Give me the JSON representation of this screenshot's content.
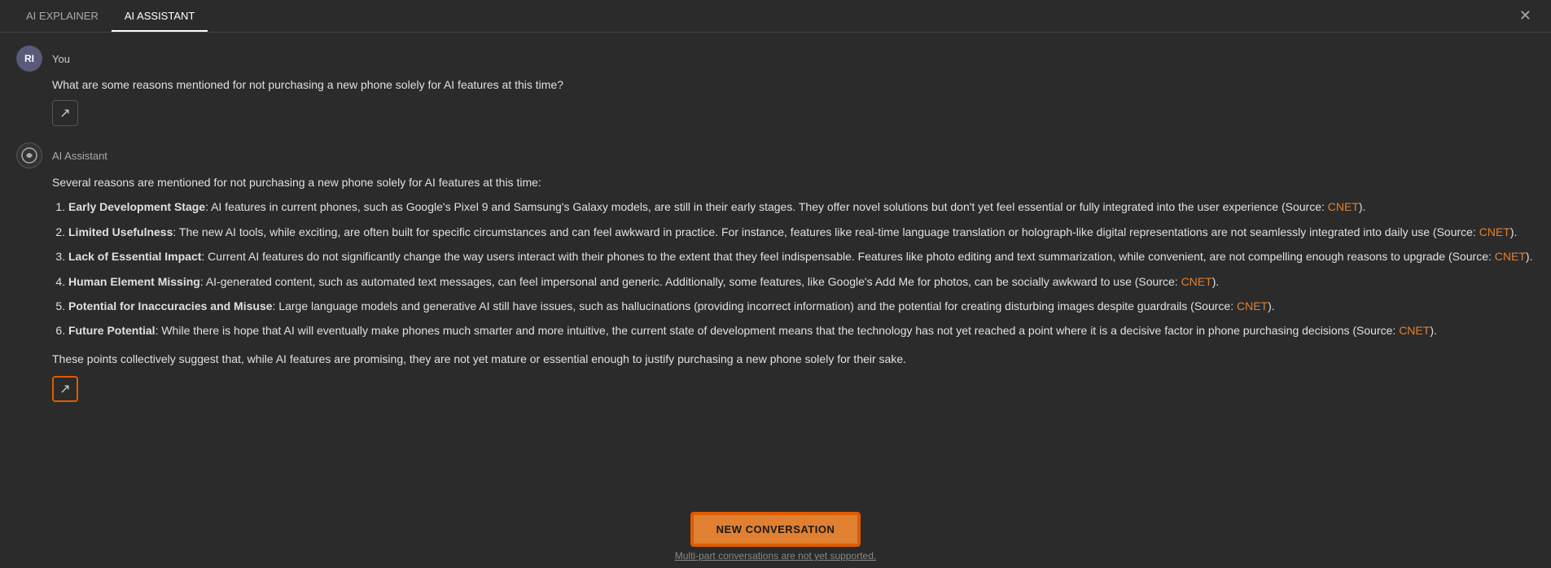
{
  "tabs": [
    {
      "id": "ai-explainer",
      "label": "AI EXPLAINER",
      "active": false
    },
    {
      "id": "ai-assistant",
      "label": "AI ASSISTANT",
      "active": true
    }
  ],
  "close_button": "✕",
  "user": {
    "initials": "RI",
    "label": "You",
    "question": "What are some reasons mentioned for not purchasing a new phone solely for AI features at this time?"
  },
  "ai_assistant": {
    "label": "AI Assistant",
    "intro": "Several reasons are mentioned for not purchasing a new phone solely for AI features at this time:",
    "reasons": [
      {
        "title": "Early Development Stage",
        "text": ": AI features in current phones, such as Google's Pixel 9 and Samsung's Galaxy models, are still in their early stages. They offer novel solutions but don't yet feel essential or fully integrated into the user experience (Source: ",
        "source": "CNET",
        "end": ")."
      },
      {
        "title": "Limited Usefulness",
        "text": ": The new AI tools, while exciting, are often built for specific circumstances and can feel awkward in practice. For instance, features like real-time language translation or holograph-like digital representations are not seamlessly integrated into daily use (Source: ",
        "source": "CNET",
        "end": ")."
      },
      {
        "title": "Lack of Essential Impact",
        "text": ": Current AI features do not significantly change the way users interact with their phones to the extent that they feel indispensable. Features like photo editing and text summarization, while convenient, are not compelling enough reasons to upgrade (Source: ",
        "source": "CNET",
        "end": ")."
      },
      {
        "title": "Human Element Missing",
        "text": ": AI-generated content, such as automated text messages, can feel impersonal and generic. Additionally, some features, like Google's Add Me for photos, can be socially awkward to use (Source: ",
        "source": "CNET",
        "end": ")."
      },
      {
        "title": "Potential for Inaccuracies and Misuse",
        "text": ": Large language models and generative AI still have issues, such as hallucinations (providing incorrect information) and the potential for creating disturbing images despite guardrails (Source: ",
        "source": "CNET",
        "end": ")."
      },
      {
        "title": "Future Potential",
        "text": ": While there is hope that AI will eventually make phones much smarter and more intuitive, the current state of development means that the technology has not yet reached a point where it is a decisive factor in phone purchasing decisions (Source: ",
        "source": "CNET",
        "end": ")."
      }
    ],
    "summary": "These points collectively suggest that, while AI features are promising, they are not yet mature or essential enough to justify purchasing a new phone solely for their sake."
  },
  "new_conversation_button": "NEW CONVERSATION",
  "multi_part_notice_prefix": "Mul",
  "multi_part_notice_underline": "ti-part conversations are not yet supported",
  "multi_part_notice_suffix": ".",
  "share_icon": "↗",
  "colors": {
    "accent": "#e08030",
    "source_link": "#e08030",
    "tab_active_border": "#ffffff",
    "highlight_border": "#e05c00"
  }
}
